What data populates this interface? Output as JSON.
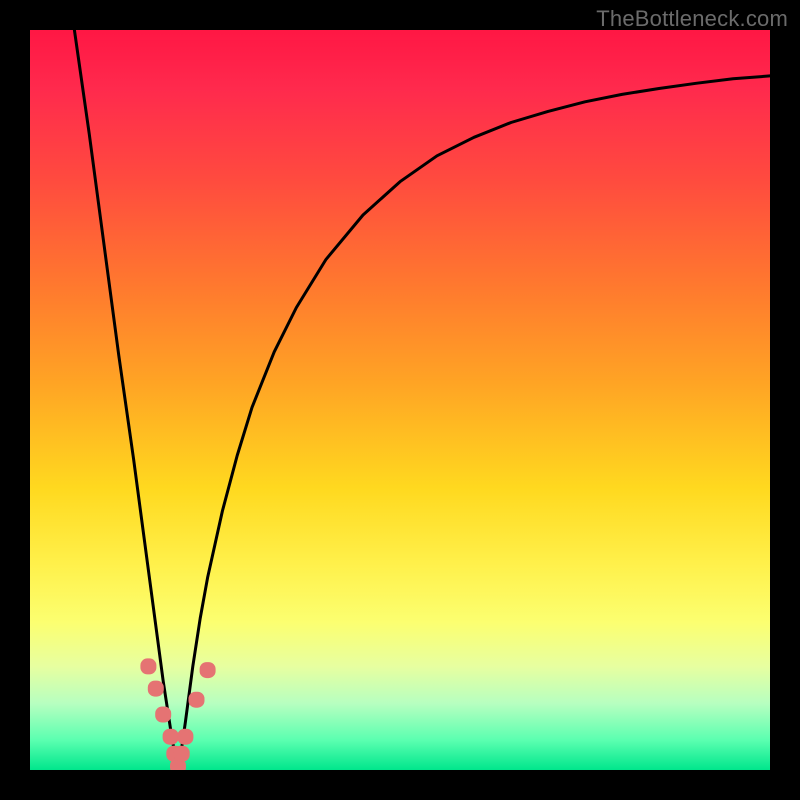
{
  "watermark": "TheBottleneck.com",
  "chart_data": {
    "type": "line",
    "title": "",
    "xlabel": "",
    "ylabel": "",
    "xlim": [
      0,
      1
    ],
    "ylim": [
      0,
      1
    ],
    "x": [
      0.06,
      0.08,
      0.1,
      0.12,
      0.14,
      0.16,
      0.17,
      0.18,
      0.19,
      0.195,
      0.2,
      0.205,
      0.21,
      0.22,
      0.23,
      0.24,
      0.26,
      0.28,
      0.3,
      0.33,
      0.36,
      0.4,
      0.45,
      0.5,
      0.55,
      0.6,
      0.65,
      0.7,
      0.75,
      0.8,
      0.85,
      0.9,
      0.95,
      1.0
    ],
    "y": [
      1.0,
      0.86,
      0.71,
      0.56,
      0.42,
      0.27,
      0.195,
      0.12,
      0.055,
      0.025,
      0.0,
      0.03,
      0.065,
      0.14,
      0.205,
      0.26,
      0.35,
      0.425,
      0.49,
      0.565,
      0.625,
      0.69,
      0.75,
      0.795,
      0.83,
      0.855,
      0.875,
      0.89,
      0.903,
      0.913,
      0.921,
      0.928,
      0.934,
      0.938
    ],
    "marker_points_x": [
      0.16,
      0.17,
      0.18,
      0.19,
      0.195,
      0.2,
      0.205,
      0.21,
      0.225,
      0.24
    ],
    "marker_points_y": [
      0.14,
      0.11,
      0.075,
      0.045,
      0.022,
      0.005,
      0.022,
      0.045,
      0.095,
      0.135
    ],
    "marker_color": "#e57373",
    "curve_color": "#000000"
  }
}
